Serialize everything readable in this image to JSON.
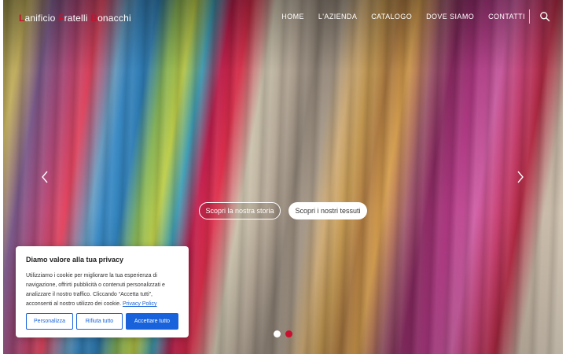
{
  "brand": {
    "parts": [
      {
        "initial": "L",
        "rest": "anificio "
      },
      {
        "initial": "F",
        "rest": "ratelli "
      },
      {
        "initial": "B",
        "rest": "onacchi"
      }
    ]
  },
  "nav": {
    "items": [
      "HOME",
      "L'AZIENDA",
      "CATALOGO",
      "DOVE SIAMO",
      "CONTATTI"
    ],
    "search_icon": "search-icon"
  },
  "hero": {
    "story_button": "Scopri la nostra storia",
    "fabrics_button": "Scopri i nostri tessuti",
    "prev_icon": "chevron-left-icon",
    "next_icon": "chevron-right-icon",
    "slide_count": 2,
    "active_slide": 2
  },
  "cookie": {
    "title": "Diamo valore alla tua privacy",
    "text": "Utilizziamo i cookie per migliorare la tua esperienza di navigazione, offrirti pubblicità o contenuti personalizzati e analizzare il nostro traffico. Cliccando “Accetta tutti”, acconsenti al nostro utilizzo dei cookie.",
    "link": "Privacy Policy",
    "customize": "Personalizza",
    "reject": "Rifiuta tutto",
    "accept": "Accettare tutto"
  },
  "colors": {
    "accent": "#c8102e",
    "cookie_primary": "#1863dc",
    "dot_inactive": "#ffffff",
    "dot_active": "#c8102e"
  }
}
